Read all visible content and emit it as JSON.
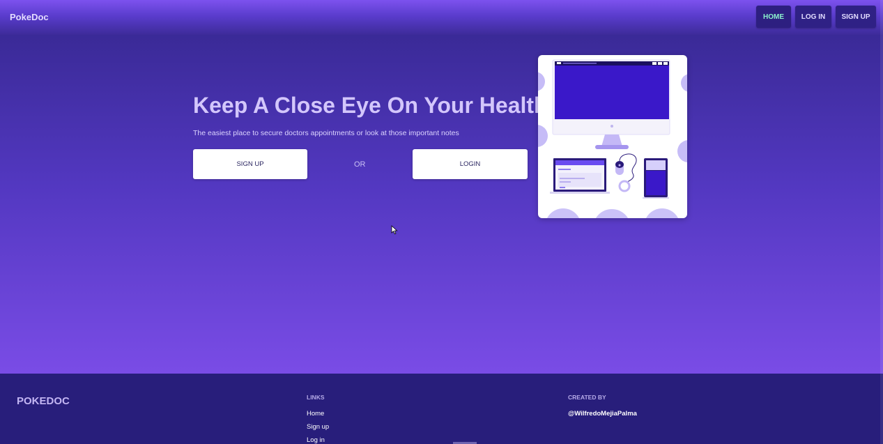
{
  "navbar": {
    "brand": "PokeDoc",
    "links": [
      {
        "label": "HOME",
        "active": true
      },
      {
        "label": "LOG IN",
        "active": false
      },
      {
        "label": "SIGN UP",
        "active": false
      }
    ]
  },
  "hero": {
    "title": "Keep A Close Eye On Your Health",
    "subtitle": "The easiest place to secure doctors appointments or look at those important notes",
    "signup_label": "SIGN UP",
    "or_label": "OR",
    "login_label": "LOGIN"
  },
  "footer": {
    "brand": "POKEDOC",
    "links_heading": "LINKS",
    "links": [
      "Home",
      "Sign up",
      "Log in"
    ],
    "created_heading": "CREATED BY",
    "author": "@WilfredoMejiaPalma"
  },
  "colors": {
    "accent": "#7b52ee",
    "nav_active_text": "#8af0cc",
    "footer_bg": "#281e7b",
    "illustration_screen": "#3a18c9"
  }
}
